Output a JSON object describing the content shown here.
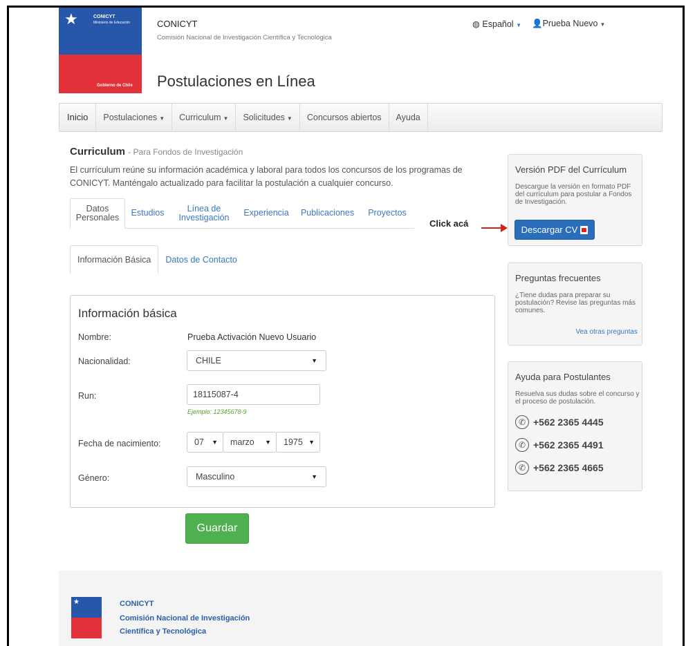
{
  "header": {
    "logo": {
      "org": "CONICYT",
      "ministry": "Ministerio de Educación",
      "government": "Gobierno de Chile"
    },
    "brand": "CONICYT",
    "brand_subtitle": "Comisión Nacional de Investigación Científica y Tecnológica",
    "app_title": "Postulaciones en Línea",
    "language": "Español",
    "user": "Prueba Nuevo"
  },
  "nav": {
    "items": [
      "Inicio",
      "Postulaciones",
      "Curriculum",
      "Solicitudes",
      "Concursos abiertos",
      "Ayuda"
    ]
  },
  "main": {
    "title": "Curriculum",
    "subtitle": "- Para Fondos de Investigación",
    "intro": "El currículum reúne su información académica y laboral para todos los concursos de los programas de CONICYT. Manténgalo actualizado para facilitar la postulación a cualquier concurso.",
    "tabs": [
      {
        "line1": "Datos",
        "line2": "Personales"
      },
      {
        "line1": "Estudios",
        "line2": ""
      },
      {
        "line1": "Línea de",
        "line2": "Investigación"
      },
      {
        "line1": "Experiencia",
        "line2": ""
      },
      {
        "line1": "Publicaciones",
        "line2": ""
      },
      {
        "line1": "Proyectos",
        "line2": ""
      }
    ],
    "subtabs": [
      "Información Básica",
      "Datos de Contacto"
    ],
    "annotation": "Click acá"
  },
  "form": {
    "title": "Información básica",
    "nombre_label": "Nombre:",
    "nombre_value": "Prueba Activación Nuevo Usuario",
    "nacionalidad_label": "Nacionalidad:",
    "nacionalidad_value": "CHILE",
    "run_label": "Run:",
    "run_value": "18115087-4",
    "run_hint": "Ejemplo: 12345678-9",
    "fecha_label": "Fecha de nacimiento:",
    "fecha_day": "07",
    "fecha_month": "marzo",
    "fecha_year": "1975",
    "genero_label": "Género:",
    "genero_value": "Masculino",
    "save_label": "Guardar"
  },
  "sidebar": {
    "pdf": {
      "title": "Versión PDF del Currículum",
      "text": "Descargue la versión en formato PDF del currículum para postular a Fondos de Investigación.",
      "button": "Descargar CV"
    },
    "faq": {
      "title": "Preguntas frecuentes",
      "text": "¿Tiene dudas para preparar su postulación? Revise las preguntas más comunes.",
      "link": "Vea otras preguntas"
    },
    "help": {
      "title": "Ayuda para Postulantes",
      "text": "Resuelva sus dudas sobre el concurso y el proceso de postulación.",
      "phones": [
        "+562 2365 4445",
        "+562 2365 4491",
        "+562 2365 4665"
      ]
    }
  },
  "footer": {
    "line1": "CONICYT",
    "line2": "Comisión Nacional de Investigación",
    "line3": "Científica y Tecnológica"
  },
  "colors": {
    "link": "#3a78c2",
    "primary_button": "#2a6ebb",
    "save_button": "#4eb04e",
    "logo_blue": "#2757a8",
    "logo_red": "#e2313a",
    "arrow": "#d02020"
  }
}
